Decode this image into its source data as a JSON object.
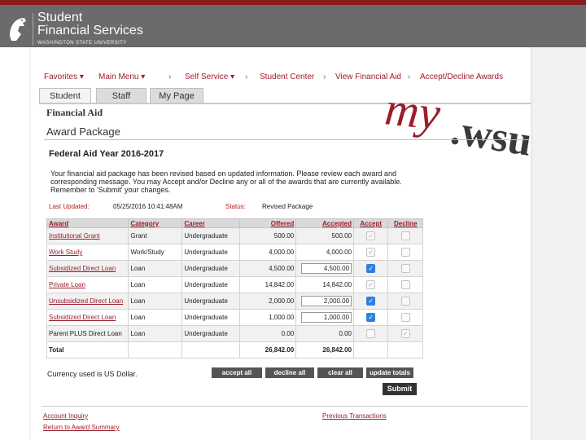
{
  "brand": {
    "title_line1": "Student",
    "title_line2": "Financial Services",
    "subtitle": "WASHINGTON STATE UNIVERSITY",
    "logo_icon": "wsu-cougar-icon"
  },
  "watermark": {
    "part1": "my",
    "part2": ".wsu"
  },
  "breadcrumbs": [
    {
      "label": "Favorites ▾"
    },
    {
      "label": "Main Menu ▾"
    },
    {
      "label": "›"
    },
    {
      "label": "Self Service ▾"
    },
    {
      "label": "›"
    },
    {
      "label": "Student Center"
    },
    {
      "label": "›"
    },
    {
      "label": "View Financial Aid"
    },
    {
      "label": "›"
    },
    {
      "label": "Accept/Decline Awards"
    }
  ],
  "tabs": [
    "Student",
    "Staff",
    "My Page"
  ],
  "headings": {
    "financial_aid": "Financial Aid",
    "award_package": "Award Package",
    "aid_year": "Federal Aid Year 2016-2017"
  },
  "message": "Your financial aid package has been revised based on updated information. Please review each award and corresponding message. You may Accept and/or Decline any or all of the awards that are currently available. Remember to 'Submit' your changes.",
  "status_info": {
    "last_updated_label": "Last Updated:",
    "last_updated_value": "05/25/2016 10:41:48AM",
    "status_label": "Status:",
    "status_value": "Revised Package"
  },
  "table": {
    "headers": [
      "Award",
      "Category",
      "Career",
      "Offered",
      "Accepted",
      "Accept",
      "Decline"
    ],
    "rows": [
      {
        "award": "Institutional Grant",
        "category": "Grant",
        "career": "Undergraduate",
        "offered": "500.00",
        "accepted": "500.00",
        "editable": false,
        "accept": "checked-disabled",
        "decline": "unchecked-disabled"
      },
      {
        "award": "Work Study",
        "category": "Work/Study",
        "career": "Undergraduate",
        "offered": "4,000.00",
        "accepted": "4,000.00",
        "editable": false,
        "accept": "checked-disabled",
        "decline": "unchecked-disabled"
      },
      {
        "award": "Subsidized Direct Loan",
        "category": "Loan",
        "career": "Undergraduate",
        "offered": "4,500.00",
        "accepted": "4,500.00",
        "editable": true,
        "accept": "checked",
        "decline": "unchecked"
      },
      {
        "award": "Private Loan",
        "category": "Loan",
        "career": "Undergraduate",
        "offered": "14,842.00",
        "accepted": "14,842.00",
        "editable": false,
        "accept": "checked-disabled",
        "decline": "unchecked-disabled"
      },
      {
        "award": "Unsubsidized Direct Loan",
        "category": "Loan",
        "career": "Undergraduate",
        "offered": "2,000.00",
        "accepted": "2,000.00",
        "editable": true,
        "accept": "checked",
        "decline": "unchecked"
      },
      {
        "award": "Subsidized Direct Loan",
        "category": "Loan",
        "career": "Undergraduate",
        "offered": "1,000.00",
        "accepted": "1,000.00",
        "editable": true,
        "accept": "checked",
        "decline": "unchecked"
      },
      {
        "award": "Parent PLUS Direct Loan",
        "category": "Loan",
        "career": "Undergraduate",
        "offered": "0.00",
        "accepted": "0.00",
        "editable": false,
        "accept": "unchecked-disabled",
        "decline": "checked-disabled"
      }
    ],
    "total": {
      "label": "Total",
      "offered": "26,842.00",
      "accepted": "26,842.00"
    }
  },
  "currency_note": "Currency used is US Dollar.",
  "buttons": {
    "accept_all": "accept all",
    "decline_all": "decline all",
    "clear_all": "clear all",
    "update_totals": "update totals",
    "submit": "Submit"
  },
  "footer_links": {
    "account_inquiry": "Account Inquiry",
    "return_summary": "Return to Award Summary",
    "previous_transactions": "Previous Transactions"
  },
  "colors": {
    "brand_red": "#9c1c2b",
    "brand_gray": "#6b6b6b",
    "checkbox_blue": "#2f7fe0"
  }
}
